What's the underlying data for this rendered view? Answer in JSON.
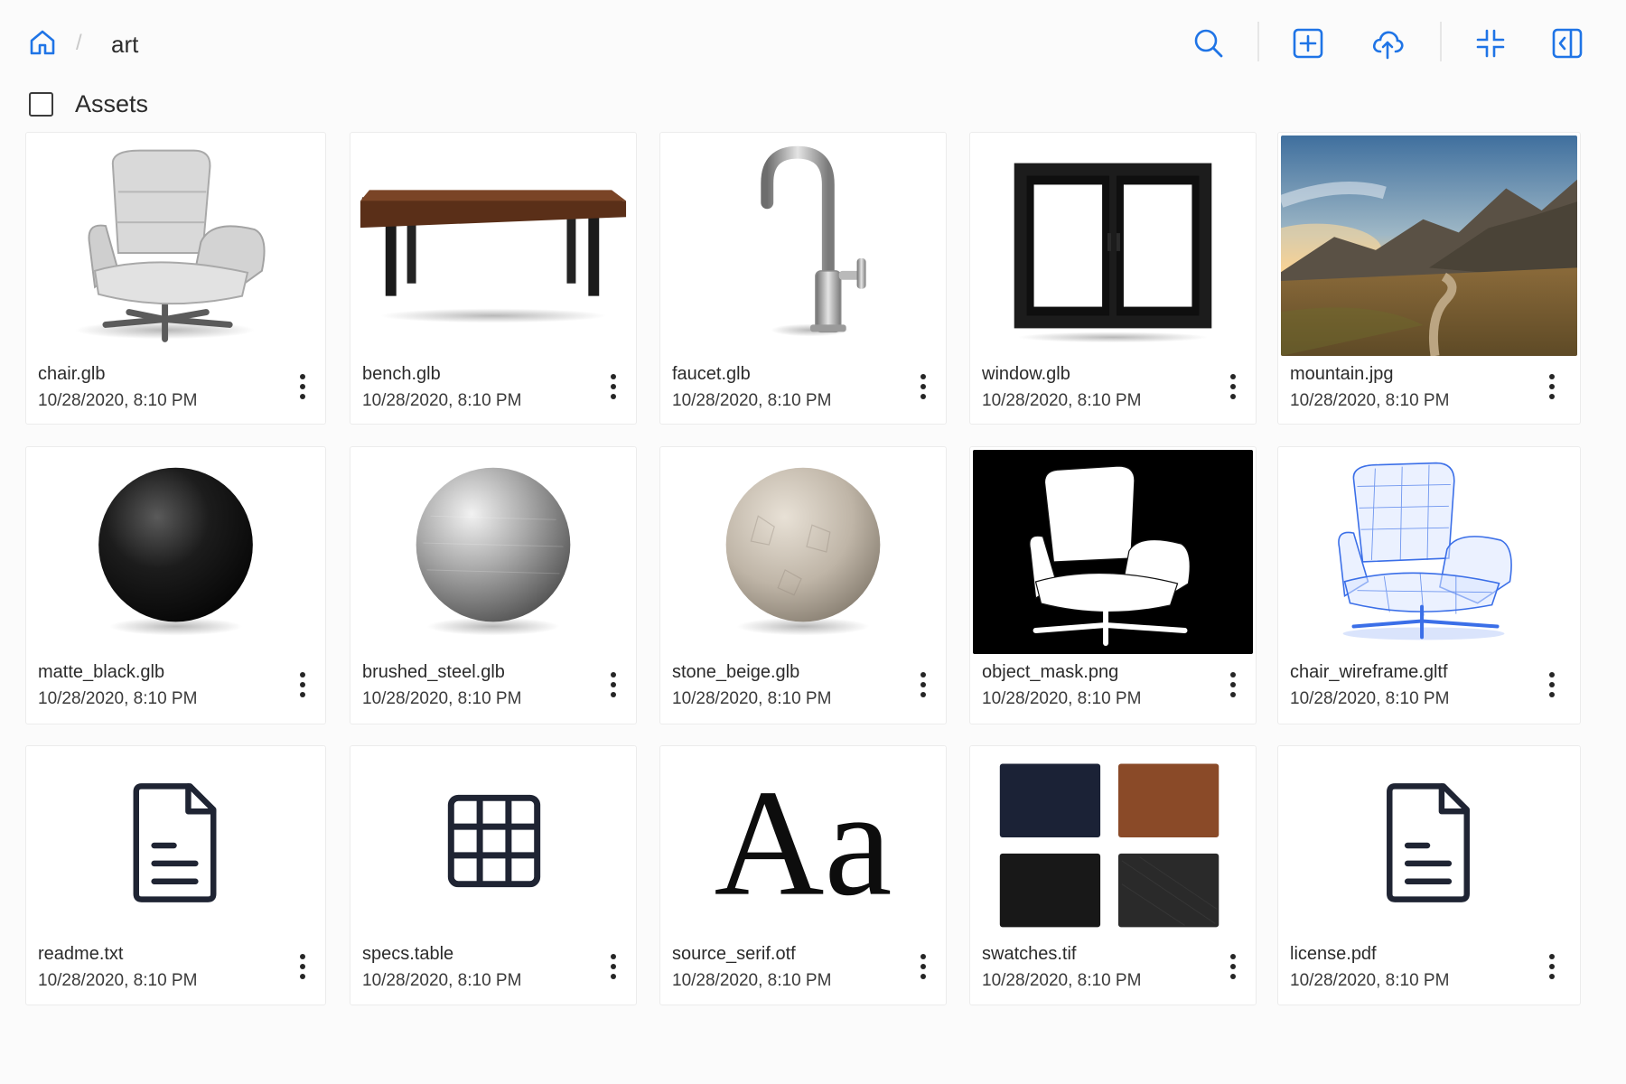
{
  "colors": {
    "accent": "#1f74e6",
    "text": "#2b2b2b",
    "border": "#ececec",
    "background": "#fbfbfb"
  },
  "breadcrumb": {
    "home_icon": "home-icon",
    "separator": "/",
    "current": "art"
  },
  "toolbar": {
    "buttons": [
      {
        "name": "search-button",
        "icon": "search-icon"
      },
      {
        "name": "new-item-button",
        "icon": "plus-square-icon"
      },
      {
        "name": "upload-button",
        "icon": "cloud-upload-icon"
      },
      {
        "name": "collapse-button",
        "icon": "minimize-icon"
      },
      {
        "name": "toggle-panel-button",
        "icon": "sidebar-collapse-icon"
      }
    ]
  },
  "section": {
    "title": "Assets",
    "select_all_checked": false
  },
  "assets": [
    {
      "name": "chair.glb",
      "date": "10/28/2020, 8:10 PM",
      "preview": "chair"
    },
    {
      "name": "bench.glb",
      "date": "10/28/2020, 8:10 PM",
      "preview": "bench"
    },
    {
      "name": "faucet.glb",
      "date": "10/28/2020, 8:10 PM",
      "preview": "faucet"
    },
    {
      "name": "window.glb",
      "date": "10/28/2020, 8:10 PM",
      "preview": "window"
    },
    {
      "name": "mountain.jpg",
      "date": "10/28/2020, 8:10 PM",
      "preview": "mountain"
    },
    {
      "name": "matte_black.glb",
      "date": "10/28/2020, 8:10 PM",
      "preview": "sphere-black"
    },
    {
      "name": "brushed_steel.glb",
      "date": "10/28/2020, 8:10 PM",
      "preview": "sphere-steel"
    },
    {
      "name": "stone_beige.glb",
      "date": "10/28/2020, 8:10 PM",
      "preview": "sphere-stone"
    },
    {
      "name": "object_mask.png",
      "date": "10/28/2020, 8:10 PM",
      "preview": "mask"
    },
    {
      "name": "chair_wireframe.gltf",
      "date": "10/28/2020, 8:10 PM",
      "preview": "wireframe"
    },
    {
      "name": "readme.txt",
      "date": "10/28/2020, 8:10 PM",
      "preview": "document-icon"
    },
    {
      "name": "specs.table",
      "date": "10/28/2020, 8:10 PM",
      "preview": "table-icon"
    },
    {
      "name": "source_serif.otf",
      "date": "10/28/2020, 8:10 PM",
      "preview": "font-sample",
      "sample_text": "Aa"
    },
    {
      "name": "swatches.tif",
      "date": "10/28/2020, 8:10 PM",
      "preview": "swatches"
    },
    {
      "name": "license.pdf",
      "date": "10/28/2020, 8:10 PM",
      "preview": "document-icon"
    }
  ]
}
